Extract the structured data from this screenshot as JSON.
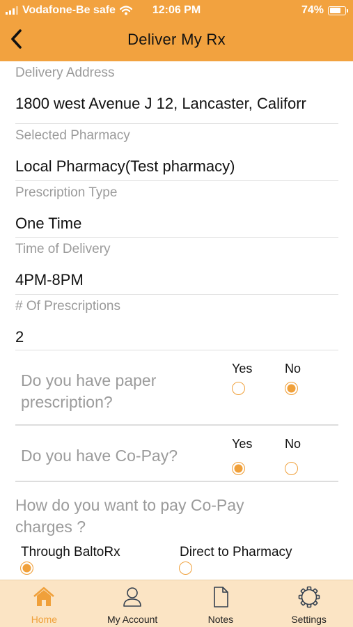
{
  "status_bar": {
    "carrier": "Vodafone-Be safe",
    "time": "12:06 PM",
    "battery": "74%",
    "battery_level": 0.74
  },
  "header": {
    "title": "Deliver My Rx"
  },
  "fields": [
    {
      "label": "Delivery Address",
      "value": "1800 west Avenue J 12, Lancaster, Califorr"
    },
    {
      "label": "Selected Pharmacy",
      "value": "Local Pharmacy(Test pharmacy)"
    },
    {
      "label": "Prescription Type",
      "value": "One Time"
    },
    {
      "label": "Time of Delivery",
      "value": "4PM-8PM"
    },
    {
      "label": "# Of Prescriptions",
      "value": "2"
    }
  ],
  "questions": [
    {
      "text": "Do you have paper prescription?",
      "line1": "Do you have paper",
      "line2": "prescription?",
      "yes_label": "Yes",
      "no_label": "No",
      "selected": "No"
    },
    {
      "text": "Do you have Co-Pay?",
      "yes_label": "Yes",
      "no_label": "No",
      "selected": "Yes"
    }
  ],
  "copay": {
    "line1": "How do you want to pay Co-Pay",
    "line2": "charges ?",
    "options": [
      "Through BaltoRx",
      "Direct to Pharmacy"
    ],
    "selected": "Through BaltoRx"
  },
  "tabs": [
    {
      "label": "Home",
      "icon": "home-icon",
      "active": true
    },
    {
      "label": "My Account",
      "icon": "person-icon",
      "active": false
    },
    {
      "label": "Notes",
      "icon": "document-icon",
      "active": false
    },
    {
      "label": "Settings",
      "icon": "gear-icon",
      "active": false
    }
  ],
  "colors": {
    "accent": "#f2a23f",
    "tabbar": "#fbe4c4",
    "label_gray": "#9b9b9b"
  }
}
